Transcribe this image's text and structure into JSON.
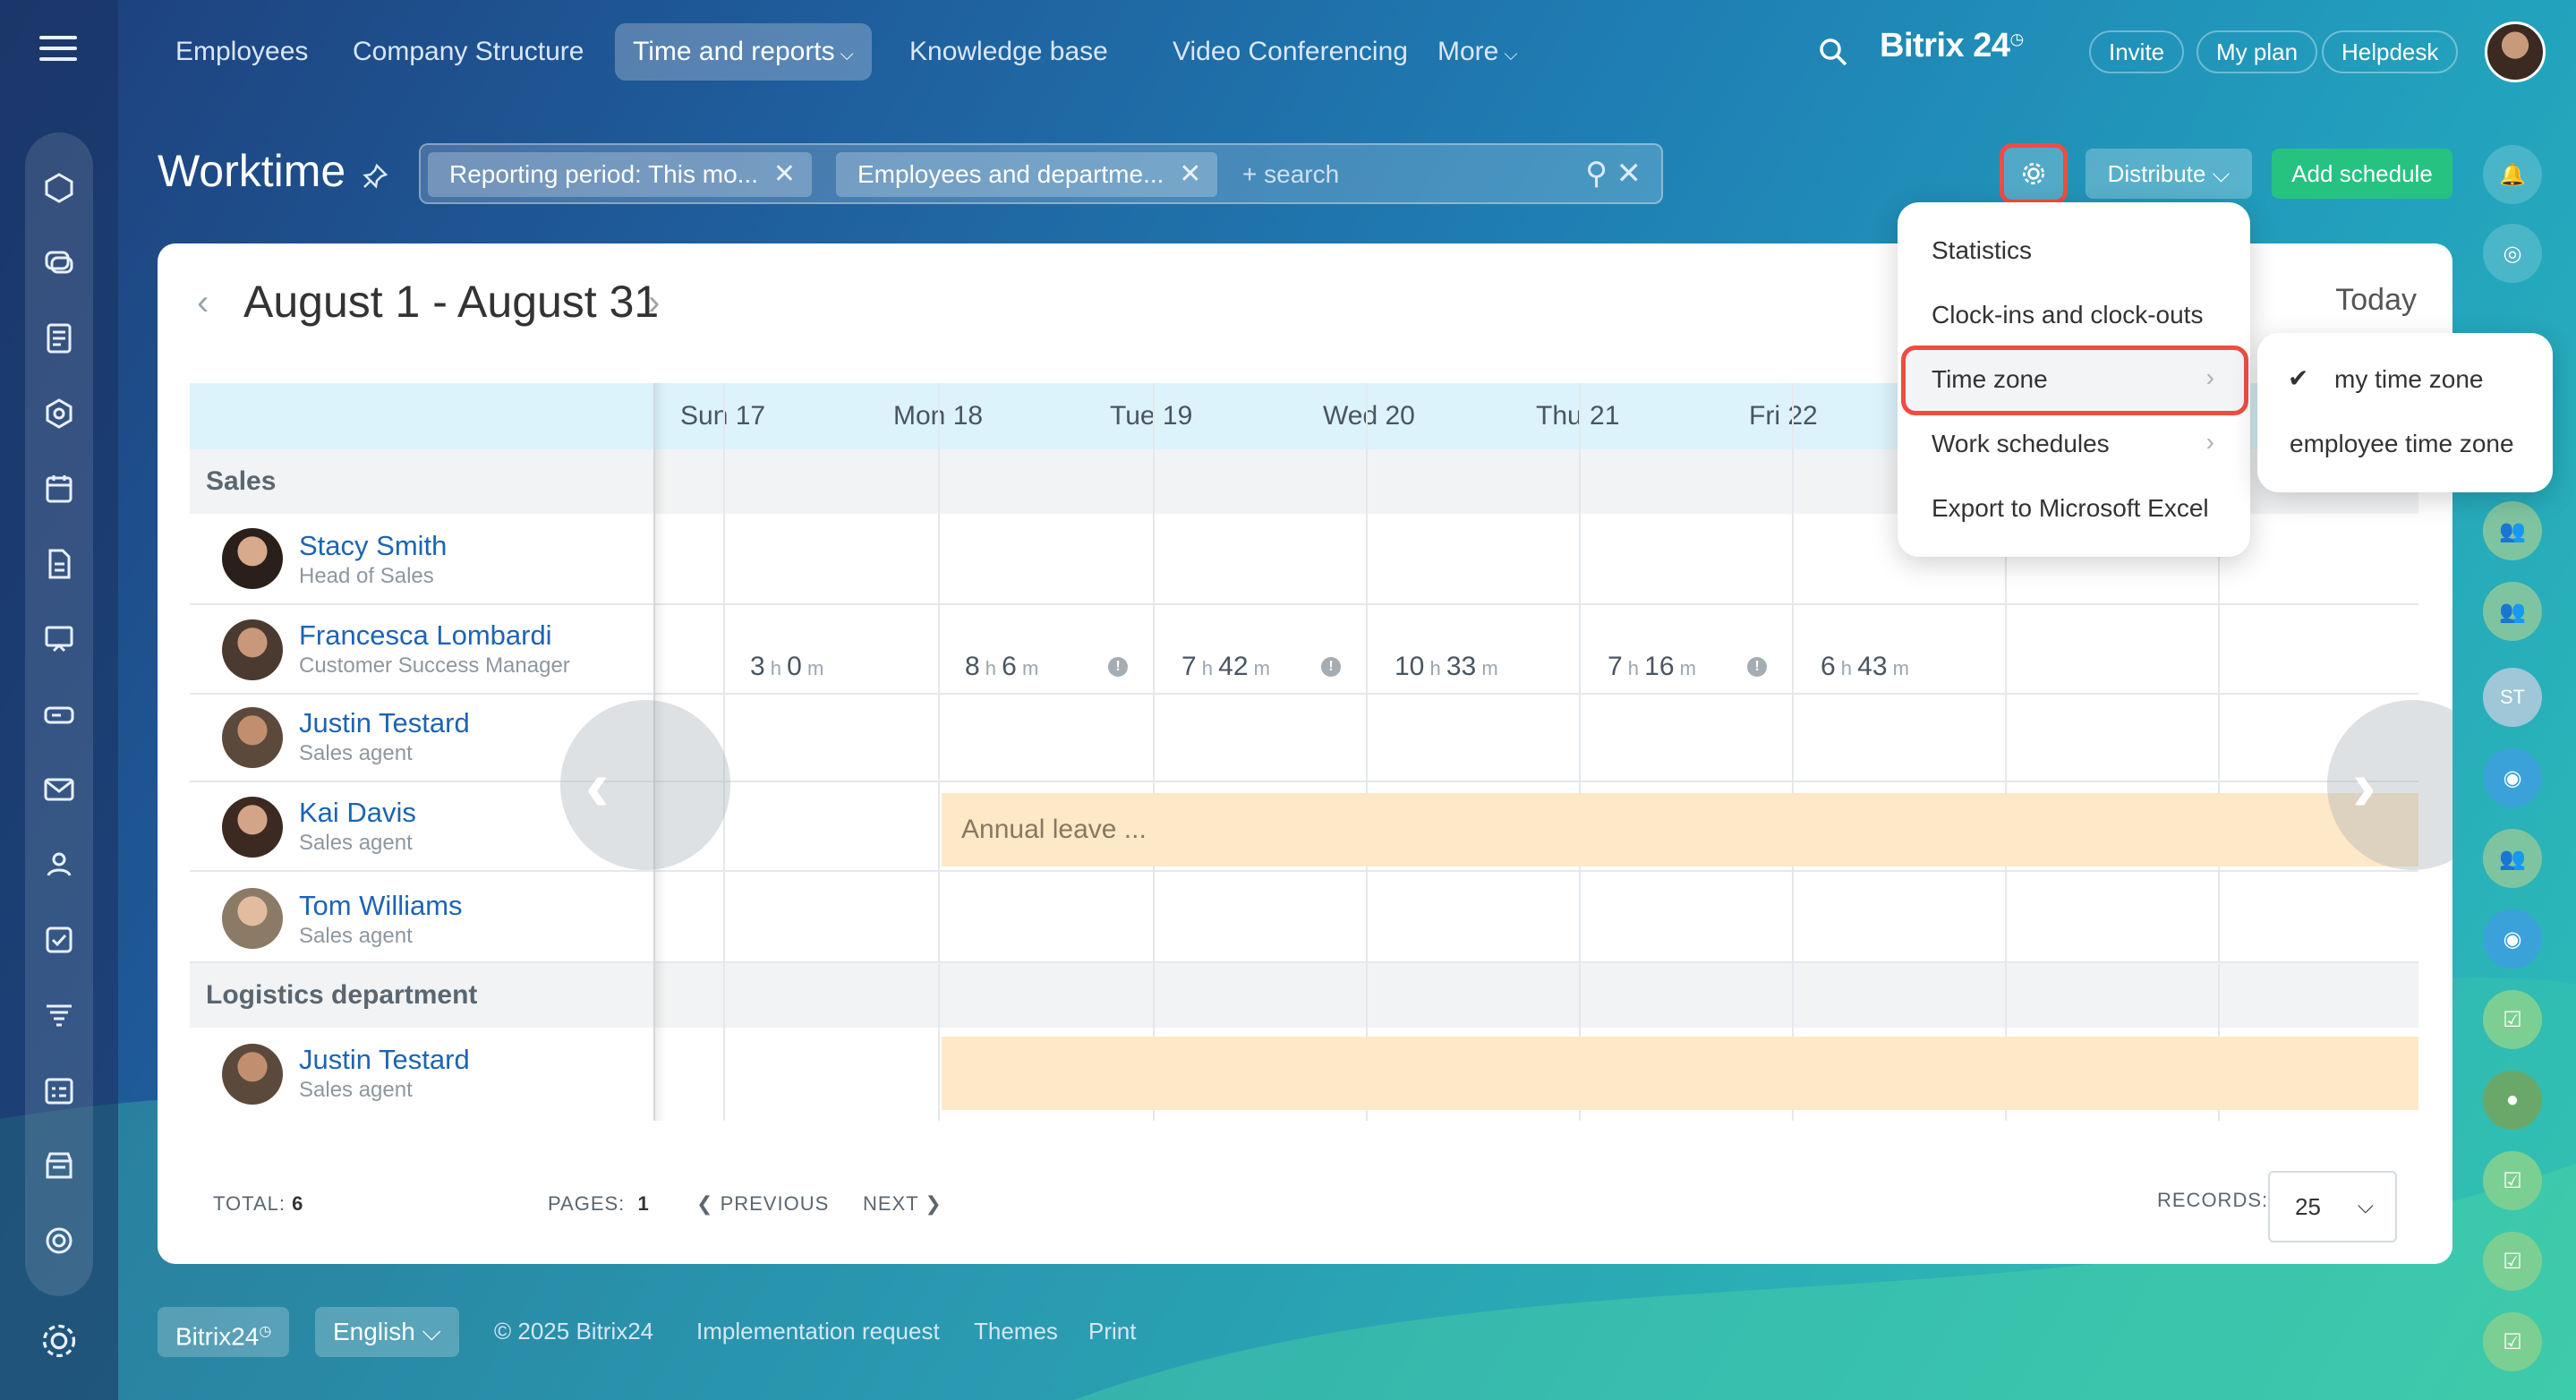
{
  "nav": {
    "items": [
      {
        "label": "Employees"
      },
      {
        "label": "Company Structure"
      },
      {
        "label": "Time and reports",
        "active": true
      },
      {
        "label": "Knowledge base"
      },
      {
        "label": "Video Conferencing"
      },
      {
        "label": "More"
      }
    ],
    "brand": "Bitrix 24",
    "invite": "Invite",
    "my_plan": "My plan",
    "helpdesk": "Helpdesk"
  },
  "header": {
    "title": "Worktime",
    "filter_chips": [
      "Reporting period: This mo...",
      "Employees and departme..."
    ],
    "search_placeholder": "+ search",
    "distribute": "Distribute",
    "add_schedule": "Add schedule"
  },
  "calendar": {
    "period": "August 1 - August 31",
    "today": "Today",
    "days": [
      "Sun 17",
      "Mon 18",
      "Tue 19",
      "Wed 20",
      "Thu 21",
      "Fri 22"
    ]
  },
  "sections": [
    {
      "label": "Sales",
      "employees": [
        {
          "name": "Stacy Smith",
          "role": "Head of Sales",
          "times": [
            {
              "h": "3",
              "m": "0",
              "warn": false
            },
            {
              "h": "8",
              "m": "6",
              "warn": true
            },
            {
              "h": "7",
              "m": "42",
              "warn": true
            },
            {
              "h": "10",
              "m": "33",
              "warn": false
            },
            {
              "h": "7",
              "m": "16",
              "warn": true
            },
            {
              "h": "6",
              "m": "43",
              "warn": false
            }
          ]
        },
        {
          "name": "Francesca Lombardi",
          "role": "Customer Success Manager"
        },
        {
          "name": "Justin Testard",
          "role": "Sales agent"
        },
        {
          "name": "Kai Davis",
          "role": "Sales agent",
          "leave": "Annual leave ..."
        },
        {
          "name": "Tom Williams",
          "role": "Sales agent"
        }
      ]
    },
    {
      "label": "Logistics department",
      "employees": [
        {
          "name": "Justin Testard",
          "role": "Sales agent"
        }
      ]
    }
  ],
  "pager": {
    "total_label": "TOTAL:",
    "total": "6",
    "pages_label": "PAGES:",
    "pages": "1",
    "previous": "PREVIOUS",
    "next": "NEXT",
    "records_label": "RECORDS:",
    "records": "25"
  },
  "settings_menu": {
    "items": [
      {
        "label": "Statistics"
      },
      {
        "label": "Clock-ins and clock-outs"
      },
      {
        "label": "Time zone",
        "submenu": true,
        "highlighted": true
      },
      {
        "label": "Work schedules",
        "submenu": true
      },
      {
        "label": "Export to Microsoft Excel"
      }
    ],
    "time_zone_submenu": [
      {
        "label": "my time zone",
        "checked": true
      },
      {
        "label": "employee time zone",
        "checked": false
      }
    ]
  },
  "right_bar": {
    "initials": "ST"
  },
  "footer": {
    "brand": "Bitrix24",
    "language": "English",
    "copyright": "© 2025 Bitrix24",
    "links": [
      "Implementation request",
      "Themes",
      "Print"
    ]
  },
  "colors": {
    "accent_red": "#ef4c43",
    "add_green": "#26c281",
    "link_blue": "#1d64b4",
    "leave_bg": "#fde8c8"
  }
}
